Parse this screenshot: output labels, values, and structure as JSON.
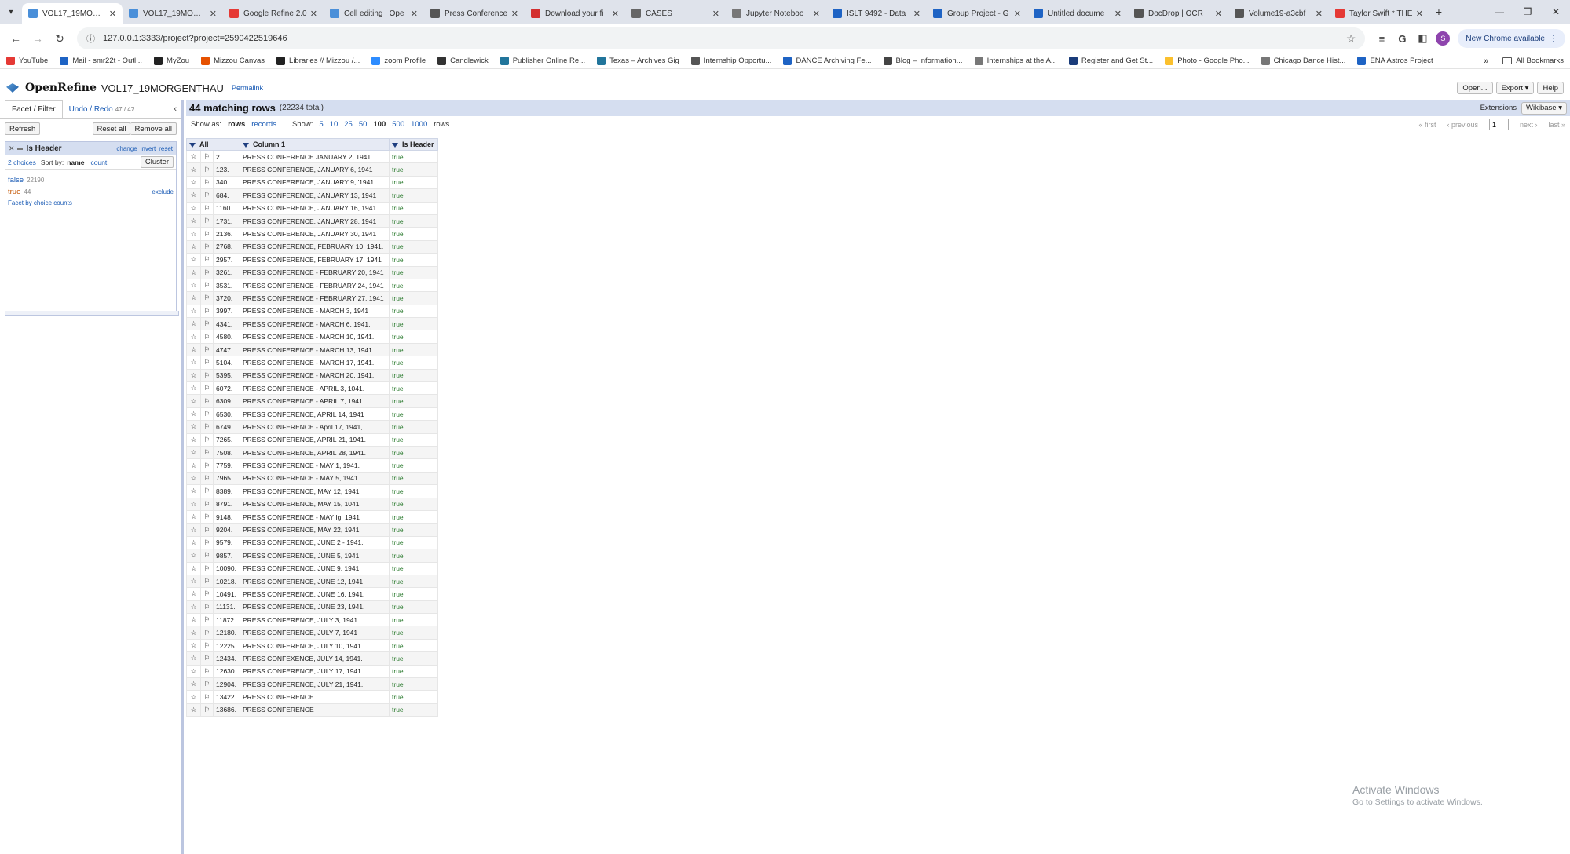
{
  "browser": {
    "tabs": [
      {
        "title": "VOL17_19MORGE",
        "color": "#4a8fd9",
        "active": true
      },
      {
        "title": "VOL17_19MORGE",
        "color": "#4a8fd9"
      },
      {
        "title": "Google Refine 2.0",
        "color": "#e53935"
      },
      {
        "title": "Cell editing | Ope",
        "color": "#4a8fd9"
      },
      {
        "title": "Press Conference",
        "color": "#555555"
      },
      {
        "title": "Download your fi",
        "color": "#d32f2f"
      },
      {
        "title": "CASES",
        "color": "#666666"
      },
      {
        "title": "Jupyter Noteboo",
        "color": "#777777"
      },
      {
        "title": "ISLT 9492 - Data",
        "color": "#1e63c4"
      },
      {
        "title": "Group Project - G",
        "color": "#1e63c4"
      },
      {
        "title": "Untitled docume",
        "color": "#1e63c4"
      },
      {
        "title": "DocDrop | OCR",
        "color": "#555555"
      },
      {
        "title": "Volume19-a3cbf",
        "color": "#555555"
      },
      {
        "title": "Taylor Swift * THE",
        "color": "#e53935"
      }
    ],
    "url": "127.0.0.1:3333/project?project=2590422519646",
    "update_label": "New Chrome available",
    "avatar_letter": "S",
    "bookmarks": [
      {
        "label": "YouTube",
        "color": "#e53935"
      },
      {
        "label": "Mail - smr22t - Outl...",
        "color": "#1e63c4"
      },
      {
        "label": "MyZou",
        "color": "#222222"
      },
      {
        "label": "Mizzou Canvas",
        "color": "#e65100"
      },
      {
        "label": "Libraries // Mizzou /...",
        "color": "#222222"
      },
      {
        "label": "zoom Profile",
        "color": "#2d8cff"
      },
      {
        "label": "Candlewick",
        "color": "#333333"
      },
      {
        "label": "Publisher Online Re...",
        "color": "#21759b"
      },
      {
        "label": "Texas – Archives Gig",
        "color": "#21759b"
      },
      {
        "label": "Internship Opportu...",
        "color": "#555555"
      },
      {
        "label": "DANCE Archiving Fe...",
        "color": "#1e63c4"
      },
      {
        "label": "Blog – Information...",
        "color": "#444444"
      },
      {
        "label": "Internships at the A...",
        "color": "#777777"
      },
      {
        "label": "Register and Get St...",
        "color": "#1a3c7a"
      },
      {
        "label": "Photo - Google Pho...",
        "color": "#fbc02d"
      },
      {
        "label": "Chicago Dance Hist...",
        "color": "#777777"
      },
      {
        "label": "ENA Astros Project",
        "color": "#1e63c4"
      }
    ],
    "all_bookmarks": "All Bookmarks"
  },
  "app": {
    "brand": "OpenRefine",
    "project": "VOL17_19MORGENTHAU",
    "permalink": "Permalink",
    "open": "Open...",
    "export": "Export ▾",
    "help": "Help"
  },
  "left": {
    "tab_facet": "Facet / Filter",
    "tab_undo": "Undo / Redo",
    "undo_count": "47 / 47",
    "refresh": "Refresh",
    "reset_all": "Reset all",
    "remove_all": "Remove all",
    "facet": {
      "title": "Is Header",
      "change": "change",
      "invert": "invert",
      "reset": "reset",
      "choices": "2 choices",
      "sort_by": "Sort by:",
      "sort_name": "name",
      "sort_count": "count",
      "cluster": "Cluster",
      "items": [
        {
          "name": "false",
          "count": "22190"
        },
        {
          "name": "true",
          "count": "44",
          "selected": true
        }
      ],
      "exclude": "exclude",
      "footer": "Facet by choice counts"
    }
  },
  "main": {
    "matching": "44 matching rows",
    "total": "(22234 total)",
    "extensions": "Extensions",
    "wikibase": "Wikibase ▾",
    "show_as": "Show as:",
    "rows": "rows",
    "records": "records",
    "show": "Show:",
    "page_sizes": [
      "5",
      "10",
      "25",
      "50",
      "100",
      "500",
      "1000"
    ],
    "rows_suffix": "rows",
    "first": "« first",
    "previous": "‹ previous",
    "page": "1",
    "next": "next ›",
    "last": "last »",
    "columns": [
      "All",
      "Column 1",
      "Is Header"
    ],
    "grid": [
      [
        "2.",
        "PRESS CONFERENCE JANUARY 2, 1941",
        "true"
      ],
      [
        "123.",
        "PRESS CONFERENCE, JANUARY 6, 1941",
        "true"
      ],
      [
        "340.",
        "PRESS CONFERENCE, JANUARY 9, '1941",
        "true"
      ],
      [
        "684.",
        "PRESS CONFERENCE, JANUARY 13, 1941",
        "true"
      ],
      [
        "1160.",
        "PRESS CONFERENCE, JANUARY 16, 1941",
        "true"
      ],
      [
        "1731.",
        "PRESS CONFERENCE, JANUARY 28, 1941 '",
        "true"
      ],
      [
        "2136.",
        "PRESS CONFERENCE, JANUARY 30, 1941",
        "true"
      ],
      [
        "2768.",
        "PRESS CONFERENCE, FEBRUARY 10, 1941.",
        "true"
      ],
      [
        "2957.",
        "PRESS CONFERENCE, FEBRUARY 17, 1941",
        "true"
      ],
      [
        "3261.",
        "PRESS CONFERENCE - FEBRUARY 20, 1941",
        "true"
      ],
      [
        "3531.",
        "PRESS CONFERENCE - FEBRUARY 24, 1941",
        "true"
      ],
      [
        "3720.",
        "PRESS CONFERENCE - FEBRUARY 27, 1941",
        "true"
      ],
      [
        "3997.",
        "PRESS CONFERENCE - MARCH 3, 1941",
        "true"
      ],
      [
        "4341.",
        "PRESS CONFERENCE - MARCH 6, 1941.",
        "true"
      ],
      [
        "4580.",
        "PRESS CONFERENCE - MARCH 10, 1941.",
        "true"
      ],
      [
        "4747.",
        "PRESS CONFERENCE - MARCH 13, 1941",
        "true"
      ],
      [
        "5104.",
        "PRESS CONFERENCE - MARCH 17, 1941.",
        "true"
      ],
      [
        "5395.",
        "PRESS CONFERENCE - MARCH 20, 1941.",
        "true"
      ],
      [
        "6072.",
        "PRESS CONFERENCE - APRIL 3, 1041.",
        "true"
      ],
      [
        "6309.",
        "PRESS CONFERENCE - APRIL 7, 1941",
        "true"
      ],
      [
        "6530.",
        "PRESS CONFERENCE, APRIL 14, 1941",
        "true"
      ],
      [
        "6749.",
        "PRESS CONFERENCE - April 17, 1941,",
        "true"
      ],
      [
        "7265.",
        "PRESS CONFERENCE, APRIL 21, 1941.",
        "true"
      ],
      [
        "7508.",
        "PRESS CONFERENCE, APRIL 28, 1941.",
        "true"
      ],
      [
        "7759.",
        "PRESS CONFERENCE - MAY 1, 1941.",
        "true"
      ],
      [
        "7965.",
        "PRESS CONFERENCE - MAY 5, 1941",
        "true"
      ],
      [
        "8389.",
        "PRESS CONFERENCE, MAY 12, 1941",
        "true"
      ],
      [
        "8791.",
        "PRESS CONFERENCE, MAY 15, 1041",
        "true"
      ],
      [
        "9148.",
        "PRESS CONFERENCE - MAY Ig, 1941",
        "true"
      ],
      [
        "9204.",
        "PRESS CONFERENCE, MAY 22, 1941",
        "true"
      ],
      [
        "9579.",
        "PRESS CONFERENCE, JUNE 2 - 1941.",
        "true"
      ],
      [
        "9857.",
        "PRESS CONFERENCE, JUNE 5, 1941",
        "true"
      ],
      [
        "10090.",
        "PRESS CONFERENCE, JUNE 9, 1941",
        "true"
      ],
      [
        "10218.",
        "PRESS CONFERENCE, JUNE 12, 1941",
        "true"
      ],
      [
        "10491.",
        "PRESS CONFERENCE, JUNE 16, 1941.",
        "true"
      ],
      [
        "11131.",
        "PRESS CONFERENCE, JUNE 23, 1941.",
        "true"
      ],
      [
        "11872.",
        "PRESS CONFERENCE, JULY 3, 1941",
        "true"
      ],
      [
        "12180.",
        "PRESS CONFERENCE, JULY 7, 1941",
        "true"
      ],
      [
        "12225.",
        "PRESS CONFERENCE, JULY 10, 1941.",
        "true"
      ],
      [
        "12434.",
        "PRESS CONFEXENCE, JULY 14, 1941.",
        "true"
      ],
      [
        "12630.",
        "PRESS CONFERENCE, JULY 17, 1941.",
        "true"
      ],
      [
        "12904.",
        "PRESS CONFERENCE, JULY 21, 1941.",
        "true"
      ],
      [
        "13422.",
        "PRESS CONFERENCE",
        "true"
      ],
      [
        "13686.",
        "PRESS CONFERENCE",
        "true"
      ]
    ]
  },
  "watermark": {
    "line1": "Activate Windows",
    "line2": "Go to Settings to activate Windows."
  }
}
